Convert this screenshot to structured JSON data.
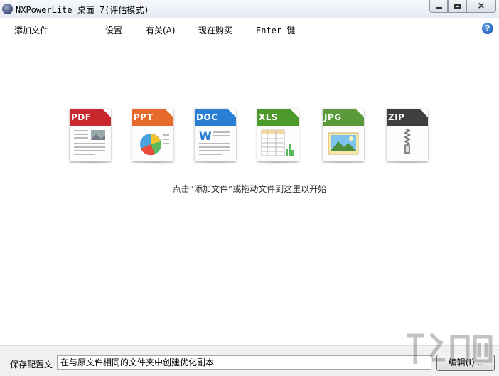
{
  "window": {
    "title": "NXPowerLite 桌面 7(评估模式)",
    "controls": {
      "minimize": "minimize",
      "maximize": "maximize",
      "close": "×"
    }
  },
  "menu": {
    "add_file": "添加文件",
    "settings": "设置",
    "about": "有关(A)",
    "buy_now": "现在购买",
    "enter_key": "Enter 键",
    "help": "?"
  },
  "file_types": [
    {
      "label": "PDF",
      "color": "#c8272d"
    },
    {
      "label": "PPT",
      "color": "#e66a2c"
    },
    {
      "label": "DOC",
      "color": "#2a7fd4"
    },
    {
      "label": "XLS",
      "color": "#4d9a2c"
    },
    {
      "label": "JPG",
      "color": "#5b9a3a"
    },
    {
      "label": "ZIP",
      "color": "#3f3f3f"
    }
  ],
  "hint": "点击“添加文件”或拖动文件到这里以开始",
  "footer": {
    "config_label": "保存配置文",
    "config_value": "在与原文件相同的文件夹中创建优化副本",
    "edit_button": "编辑(I)..."
  }
}
